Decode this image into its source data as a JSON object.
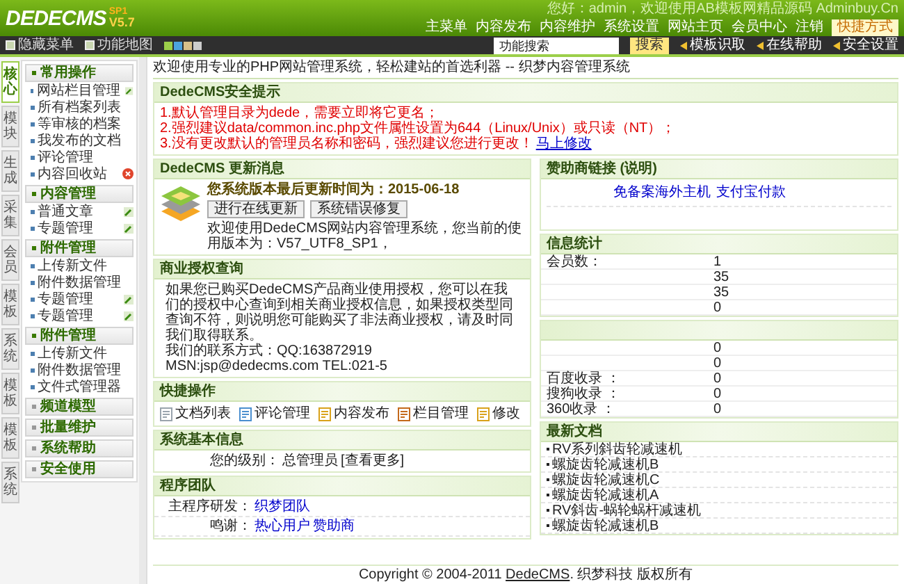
{
  "logo": {
    "name": "DEDECMS",
    "version": "V5.7",
    "tag": "SP1"
  },
  "greeting": "您好：admin，欢迎使用AB模板网精品源码 Adminbuy.Cn",
  "top_links": [
    "主菜单",
    "内容发布",
    "内容维护",
    "系统设置",
    "网站主页",
    "会员中心",
    "注销"
  ],
  "shortcut": "快捷方式",
  "toolbar": {
    "items": [
      "隐藏菜单",
      "功能地图"
    ],
    "search": {
      "placeholder": "功能搜索"
    },
    "search_button": "搜索",
    "links": [
      "模板识取",
      "在线帮助",
      "安全设置"
    ]
  },
  "side_tabs": [
    {
      "label": "核心",
      "selected": true
    },
    {
      "label": "模块",
      "selected": false
    },
    {
      "label": "生成",
      "selected": false
    },
    {
      "label": "采集",
      "selected": false
    },
    {
      "label": "会员",
      "selected": false
    },
    {
      "label": "模板",
      "selected": false
    },
    {
      "label": "系统",
      "selected": false
    },
    {
      "label": "模板",
      "selected": false
    },
    {
      "label": "模板",
      "selected": false
    },
    {
      "label": "系统",
      "selected": false
    }
  ],
  "menu": [
    {
      "title": "常用操作",
      "expanded": true,
      "items": [
        {
          "label": "网站栏目管理",
          "kind": "add"
        },
        {
          "label": "所有档案列表",
          "kind": "plain"
        },
        {
          "label": "等审核的档案",
          "kind": "plain"
        },
        {
          "label": "我发布的文档",
          "kind": "plain"
        },
        {
          "label": "评论管理",
          "kind": "plain"
        },
        {
          "label": "内容回收站",
          "kind": "trash"
        }
      ]
    },
    {
      "title": "内容管理",
      "expanded": true,
      "items": [
        {
          "label": "普通文章",
          "kind": "add"
        },
        {
          "label": "专题管理",
          "kind": "add"
        }
      ]
    },
    {
      "title": "附件管理",
      "expanded": true,
      "items": [
        {
          "label": "上传新文件",
          "kind": "plain"
        },
        {
          "label": "附件数据管理",
          "kind": "plain"
        },
        {
          "label": "专题管理",
          "kind": "add"
        },
        {
          "label": "专题管理",
          "kind": "add"
        }
      ]
    },
    {
      "title": "附件管理",
      "expanded": true,
      "items": [
        {
          "label": "上传新文件",
          "kind": "plain"
        },
        {
          "label": "附件数据管理",
          "kind": "plain"
        },
        {
          "label": "文件式管理器",
          "kind": "plain"
        }
      ]
    },
    {
      "title": "频道模型",
      "expanded": false
    },
    {
      "title": "批量维护",
      "expanded": false
    },
    {
      "title": "系统帮助",
      "expanded": false
    },
    {
      "title": "安全使用",
      "expanded": false
    }
  ],
  "welcome": "欢迎使用专业的PHP网站管理系统，轻松建站的首选利器 -- 织梦内容管理系统",
  "security": {
    "title": "DedeCMS安全提示",
    "lines": [
      "1.默认管理目录为dede，需要立即将它更名；",
      "2.强烈建议data/common.inc.php文件属性设置为644（Linux/Unix）或只读（NT）；",
      "3.没有更改默认的管理员名称和密码，强烈建议您进行更改！"
    ],
    "link": "马上修改"
  },
  "update": {
    "title": "DedeCMS 更新消息",
    "headline": "您系统版本最后更新时间为：2015-06-18",
    "buttons": [
      "进行在线更新",
      "系统错误修复"
    ],
    "text": "欢迎使用DedeCMS网站内容管理系统，您当前的使用版本为：V57_UTF8_SP1，"
  },
  "license": {
    "title": "商业授权查询",
    "text": "如果您已购买DedeCMS产品商业使用授权，您可以在我们的授权中心查询到相关商业授权信息，如果授权类型同查询不符，则说明您可能购买了非法商业授权，请及时同我们取得联系。",
    "contact": "我们的联系方式：QQ:163872919 MSN:jsp@dedecms.com TEL:021-5"
  },
  "quick": {
    "title": "快捷操作",
    "items": [
      "文档列表",
      "评论管理",
      "内容发布",
      "栏目管理",
      "修改"
    ]
  },
  "sysinfo": {
    "title": "系统基本信息",
    "label": "您的级别：",
    "value": "总管理员",
    "more": "[查看更多]"
  },
  "team": {
    "title": "程序团队",
    "rows": [
      {
        "label": "主程序研发：",
        "links": [
          "织梦团队"
        ]
      },
      {
        "label": "鸣谢：",
        "links": [
          "热心用户",
          "赞助商"
        ]
      }
    ]
  },
  "sponsor": {
    "title": "赞助商链接 (说明)",
    "links": [
      "免备案海外主机",
      "支付宝付款"
    ]
  },
  "stats": {
    "title": "信息统计",
    "rows": [
      {
        "label": "会员数：",
        "value": "1"
      },
      {
        "value": "35"
      },
      {
        "value": "35"
      },
      {
        "value": "0"
      }
    ]
  },
  "stats2": {
    "rows": [
      {
        "value": "0"
      },
      {
        "value": "0"
      },
      {
        "label": "百度收录 ：",
        "value": "0"
      },
      {
        "label": "搜狗收录 ：",
        "value": "0"
      },
      {
        "label": "360收录 ：",
        "value": "0"
      }
    ]
  },
  "latest": {
    "title": "最新文档",
    "items": [
      "RV系列斜齿轮减速机",
      "螺旋齿轮减速机B",
      "螺旋齿轮减速机C",
      "螺旋齿轮减速机A",
      "RV斜齿-蜗轮蜗杆减速机",
      "螺旋齿轮减速机B"
    ]
  },
  "footer": {
    "before": "Copyright © 2004-2011 ",
    "link": "DedeCMS",
    "after": ". 织梦科技 版权所有"
  }
}
